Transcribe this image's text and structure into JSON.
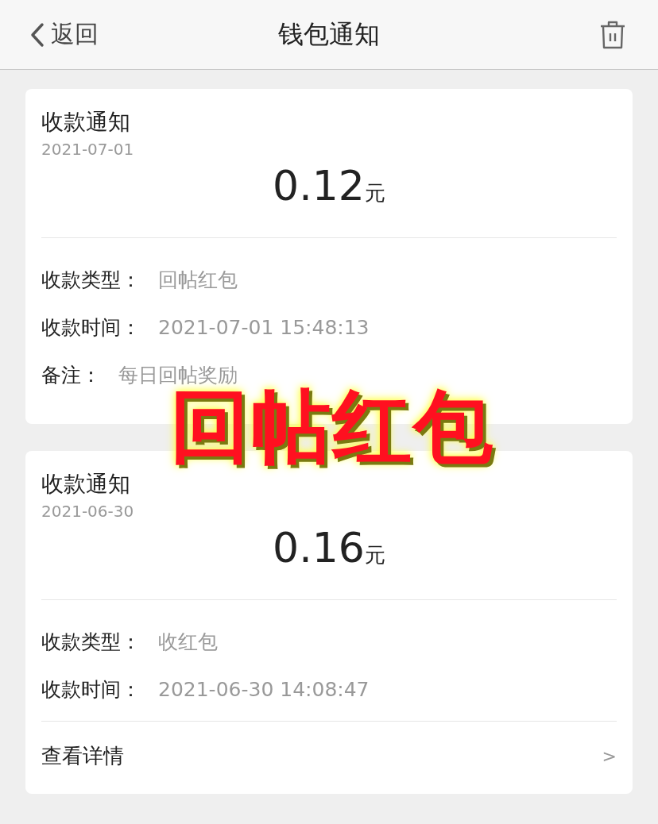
{
  "nav_bar": {
    "back_label": "返回",
    "title": "钱包通知"
  },
  "notices": [
    {
      "title": "收款通知",
      "date": "2021-07-01",
      "amount": "0.12",
      "unit": "元",
      "fields": [
        {
          "label": "收款类型：",
          "value": "回帖红包"
        },
        {
          "label": "收款时间：",
          "value": "2021-07-01 15:48:13"
        },
        {
          "label": "备注：",
          "value": "每日回帖奖励"
        }
      ]
    },
    {
      "title": "收款通知",
      "date": "2021-06-30",
      "amount": "0.16",
      "unit": "元",
      "fields": [
        {
          "label": "收款类型：",
          "value": "收红包"
        },
        {
          "label": "收款时间：",
          "value": "2021-06-30 14:08:47"
        }
      ],
      "details_link": {
        "label": "查看详情",
        "arrow": ">"
      }
    }
  ],
  "overlay_caption": "回帖红包"
}
